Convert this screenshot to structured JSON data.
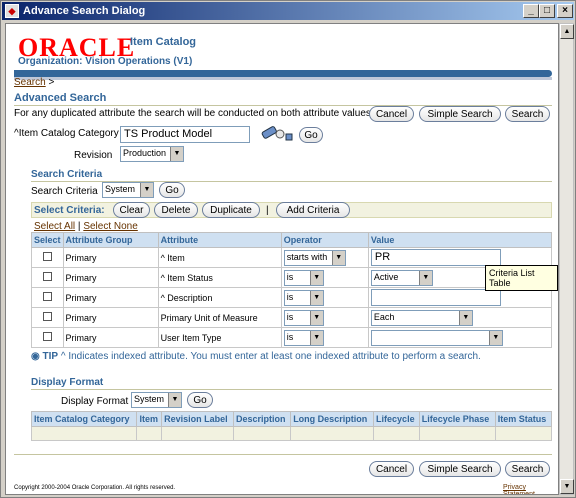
{
  "window": {
    "title": "Advance Search Dialog"
  },
  "header": {
    "logo": "ORACLE",
    "product": "Item Catalog",
    "organization": "Organization: Vision Operations (V1)"
  },
  "breadcrumb": {
    "link": "Search",
    "sep": ">"
  },
  "advanced": {
    "title": "Advanced Search",
    "note": "For any duplicated attribute the search will be conducted on both attribute values.",
    "cancel": "Cancel",
    "simple": "Simple Search",
    "search": "Search"
  },
  "catalog": {
    "label": "^Item Catalog Category",
    "value": "TS Product Model",
    "go": "Go"
  },
  "revision": {
    "label": "Revision",
    "value": "Production"
  },
  "criteria": {
    "title": "Search Criteria",
    "label": "Search Criteria",
    "value": "System",
    "go": "Go",
    "select_label": "Select Criteria:",
    "clear": "Clear",
    "delete": "Delete",
    "duplicate": "Duplicate",
    "sep": "|",
    "add": "Add Criteria",
    "select_all": "Select All",
    "select_none": "Select None",
    "select_sep": "|",
    "headers": [
      "Select",
      "Attribute Group",
      "Attribute",
      "Operator",
      "Value"
    ],
    "rows": [
      {
        "group": "Primary",
        "attr": "^ Item",
        "op": "starts with",
        "value": "PR",
        "vtype": "text"
      },
      {
        "group": "Primary",
        "attr": "^ Item Status",
        "op": "is",
        "value": "Active",
        "vtype": "select"
      },
      {
        "group": "Primary",
        "attr": "^ Description",
        "op": "is",
        "value": "",
        "vtype": "text"
      },
      {
        "group": "Primary",
        "attr": "Primary Unit of Measure",
        "op": "is",
        "value": "Each",
        "vtype": "select"
      },
      {
        "group": "Primary",
        "attr": "User Item Type",
        "op": "is",
        "value": "",
        "vtype": "select"
      }
    ],
    "tip_label": "TIP",
    "tip": "^ Indicates indexed attribute. You must enter at least one indexed attribute to perform a search.",
    "tooltip": "Criteria List Table"
  },
  "display": {
    "title": "Display Format",
    "label": "Display Format",
    "value": "System",
    "go": "Go",
    "headers": [
      "Item Catalog Category",
      "Item",
      "Revision Label",
      "Description",
      "Long Description",
      "Lifecycle",
      "Lifecycle Phase",
      "Item Status"
    ]
  },
  "footer": {
    "copyright": "Copyright 2000-2004 Oracle Corporation. All rights reserved.",
    "privacy": "Privacy Statement",
    "cancel": "Cancel",
    "simple": "Simple Search",
    "search": "Search"
  }
}
